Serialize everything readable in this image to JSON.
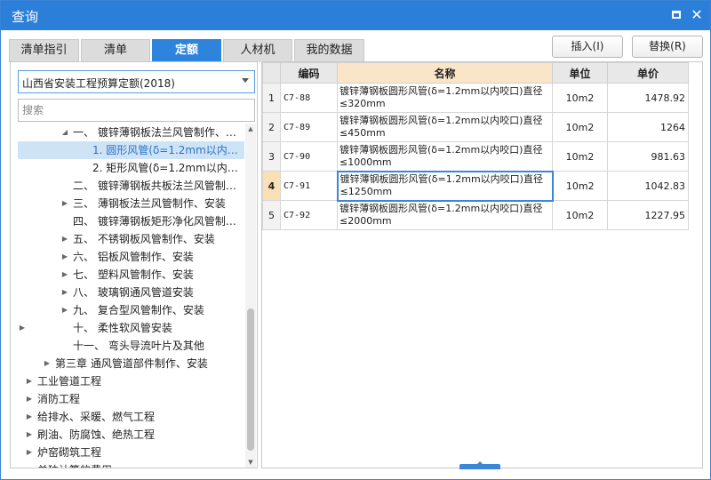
{
  "window": {
    "title": "查询",
    "minimize_glyph": "□",
    "close_glyph": "✕"
  },
  "tabs": [
    {
      "label": "清单指引",
      "active": false
    },
    {
      "label": "清单",
      "active": false
    },
    {
      "label": "定额",
      "active": true
    },
    {
      "label": "人材机",
      "active": false
    },
    {
      "label": "我的数据",
      "active": false
    }
  ],
  "actions": {
    "insert_label": "插入(I)",
    "replace_label": "替换(R)"
  },
  "library": {
    "selected": "山西省安装工程预算定额(2018)"
  },
  "search": {
    "placeholder": "搜索",
    "value": ""
  },
  "tree": [
    {
      "label": "一、 镀锌薄钢板法兰风管制作、…",
      "arrow": "◢",
      "selected": false
    },
    {
      "label": "1. 圆形风管(δ=1.2mm以内…",
      "arrow": "",
      "selected": true
    },
    {
      "label": "2. 矩形风管(δ=1.2mm以内…",
      "arrow": "",
      "selected": false
    },
    {
      "label": "二、 镀锌薄钢板共板法兰风管制…",
      "arrow": "",
      "selected": false
    },
    {
      "label": "三、 薄钢板法兰风管制作、安装",
      "arrow": "▶",
      "selected": false
    },
    {
      "label": "四、 镀锌薄钢板矩形净化风管制…",
      "arrow": "",
      "selected": false
    },
    {
      "label": "五、 不锈钢板风管制作、安装",
      "arrow": "▶",
      "selected": false
    },
    {
      "label": "六、 铝板风管制作、安装",
      "arrow": "▶",
      "selected": false
    },
    {
      "label": "七、 塑料风管制作、安装",
      "arrow": "▶",
      "selected": false
    },
    {
      "label": "八、 玻璃钢通风管道安装",
      "arrow": "▶",
      "selected": false
    },
    {
      "label": "九、 复合型风管制作、安装",
      "arrow": "▶",
      "selected": false
    },
    {
      "label": "十、 柔性软风管安装",
      "arrow": "▶",
      "selected": false
    },
    {
      "label": "十一、 弯头导流叶片及其他",
      "arrow": "",
      "selected": false
    },
    {
      "label": "第三章 通风管道部件制作、安装",
      "arrow": "▶",
      "selected": false
    },
    {
      "label": "工业管道工程",
      "arrow": "▶",
      "selected": false
    },
    {
      "label": "消防工程",
      "arrow": "▶",
      "selected": false
    },
    {
      "label": "给排水、采暖、燃气工程",
      "arrow": "▶",
      "selected": false
    },
    {
      "label": "刷油、防腐蚀、绝热工程",
      "arrow": "▶",
      "selected": false
    },
    {
      "label": "炉窑砌筑工程",
      "arrow": "▶",
      "selected": false
    },
    {
      "label": "单独计算的费用",
      "arrow": "",
      "selected": false
    }
  ],
  "grid": {
    "headers": {
      "code": "编码",
      "name": "名称",
      "unit": "单位",
      "price": "单价"
    },
    "rows": [
      {
        "no": "1",
        "code": "C7-88",
        "name": "镀锌薄钢板圆形风管(δ=1.2mm以内咬口)直径≤320mm",
        "unit": "10m2",
        "price": "1478.92"
      },
      {
        "no": "2",
        "code": "C7-89",
        "name": "镀锌薄钢板圆形风管(δ=1.2mm以内咬口)直径≤450mm",
        "unit": "10m2",
        "price": "1264"
      },
      {
        "no": "3",
        "code": "C7-90",
        "name": "镀锌薄钢板圆形风管(δ=1.2mm以内咬口)直径≤1000mm",
        "unit": "10m2",
        "price": "981.63"
      },
      {
        "no": "4",
        "code": "C7-91",
        "name": "镀锌薄钢板圆形风管(δ=1.2mm以内咬口)直径≤1250mm",
        "unit": "10m2",
        "price": "1042.83"
      },
      {
        "no": "5",
        "code": "C7-92",
        "name": "镀锌薄钢板圆形风管(δ=1.2mm以内咬口)直径≤2000mm",
        "unit": "10m2",
        "price": "1227.95"
      }
    ],
    "current_row": 4
  },
  "colors": {
    "title_bar": "#2b7fd9",
    "active_tab": "#2e83dc",
    "selected_tree_bg": "#cfe3f7",
    "selected_tree_text": "#2a73c8",
    "name_header_bg": "#fbe5c8",
    "current_row_marker": "#fbe0b6"
  }
}
